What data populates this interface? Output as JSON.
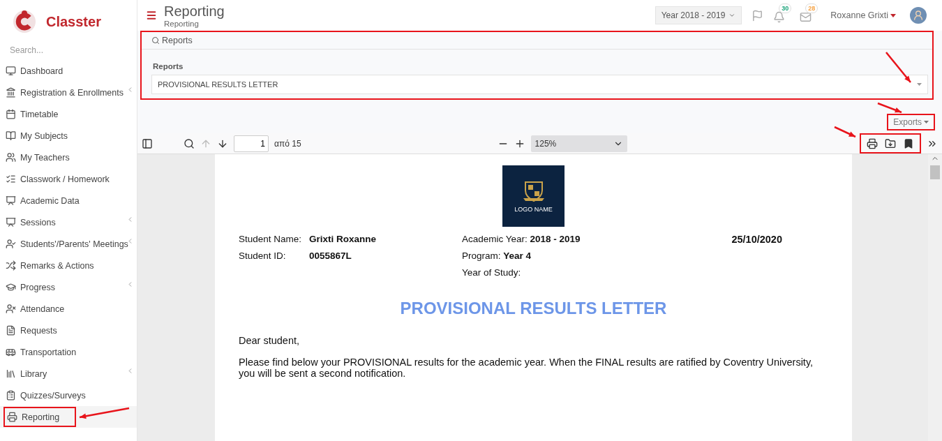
{
  "brand": {
    "name": "Classter"
  },
  "sidebar": {
    "search": {
      "placeholder": "Search..."
    },
    "items": [
      {
        "label": "Dashboard",
        "expandable": false,
        "selected": false,
        "highlighted": false
      },
      {
        "label": "Registration & Enrollments",
        "expandable": true,
        "selected": false,
        "highlighted": false
      },
      {
        "label": "Timetable",
        "expandable": false,
        "selected": false,
        "highlighted": false
      },
      {
        "label": "My Subjects",
        "expandable": false,
        "selected": false,
        "highlighted": false
      },
      {
        "label": "My Teachers",
        "expandable": false,
        "selected": false,
        "highlighted": false
      },
      {
        "label": "Classwork / Homework",
        "expandable": false,
        "selected": false,
        "highlighted": false
      },
      {
        "label": "Academic Data",
        "expandable": false,
        "selected": false,
        "highlighted": false
      },
      {
        "label": "Sessions",
        "expandable": true,
        "selected": false,
        "highlighted": false
      },
      {
        "label": "Students'/Parents' Meetings",
        "expandable": true,
        "selected": false,
        "highlighted": false
      },
      {
        "label": "Remarks & Actions",
        "expandable": false,
        "selected": false,
        "highlighted": false
      },
      {
        "label": "Progress",
        "expandable": true,
        "selected": false,
        "highlighted": false
      },
      {
        "label": "Attendance",
        "expandable": false,
        "selected": false,
        "highlighted": false
      },
      {
        "label": "Requests",
        "expandable": false,
        "selected": false,
        "highlighted": false
      },
      {
        "label": "Transportation",
        "expandable": false,
        "selected": false,
        "highlighted": false
      },
      {
        "label": "Library",
        "expandable": true,
        "selected": false,
        "highlighted": false
      },
      {
        "label": "Quizzes/Surveys",
        "expandable": false,
        "selected": false,
        "highlighted": false
      },
      {
        "label": "Reporting",
        "expandable": false,
        "selected": true,
        "highlighted": true
      }
    ]
  },
  "header": {
    "title": "Reporting",
    "breadcrumb": "Reporting",
    "year_select": "Year 2018 - 2019",
    "notifications": [
      {
        "kind": "bell",
        "count": "30",
        "color": "#1aa37a"
      },
      {
        "kind": "mail",
        "count": "28",
        "color": "#f5a142"
      }
    ],
    "user": "Roxanne Grixti"
  },
  "reports_panel": {
    "legend": "Reports",
    "label": "Reports",
    "value": "PROVISIONAL RESULTS LETTER",
    "highlighted": true
  },
  "exports": {
    "label": "Exports",
    "highlighted": true
  },
  "pdf_toolbar": {
    "page": "1",
    "page_count": "από 15",
    "zoom": "125%",
    "tools_highlighted": true
  },
  "document": {
    "logo_text": "LOGO NAME",
    "left_fields": [
      {
        "label": "Student Name:",
        "value": "Grixti Roxanne"
      },
      {
        "label": "Student ID:",
        "value": "0055867L"
      }
    ],
    "middle_fields": [
      "Academic Year: **2018 - 2019**",
      "Program: **Year 4**",
      "Year of Study:"
    ],
    "date": "25/10/2020",
    "title": "PROVISIONAL RESULTS LETTER",
    "greeting": "Dear student,",
    "body": "Please find below your PROVISIONAL results for the academic year. When the FINAL results are ratified by Coventry University, you will be sent a second notification."
  }
}
